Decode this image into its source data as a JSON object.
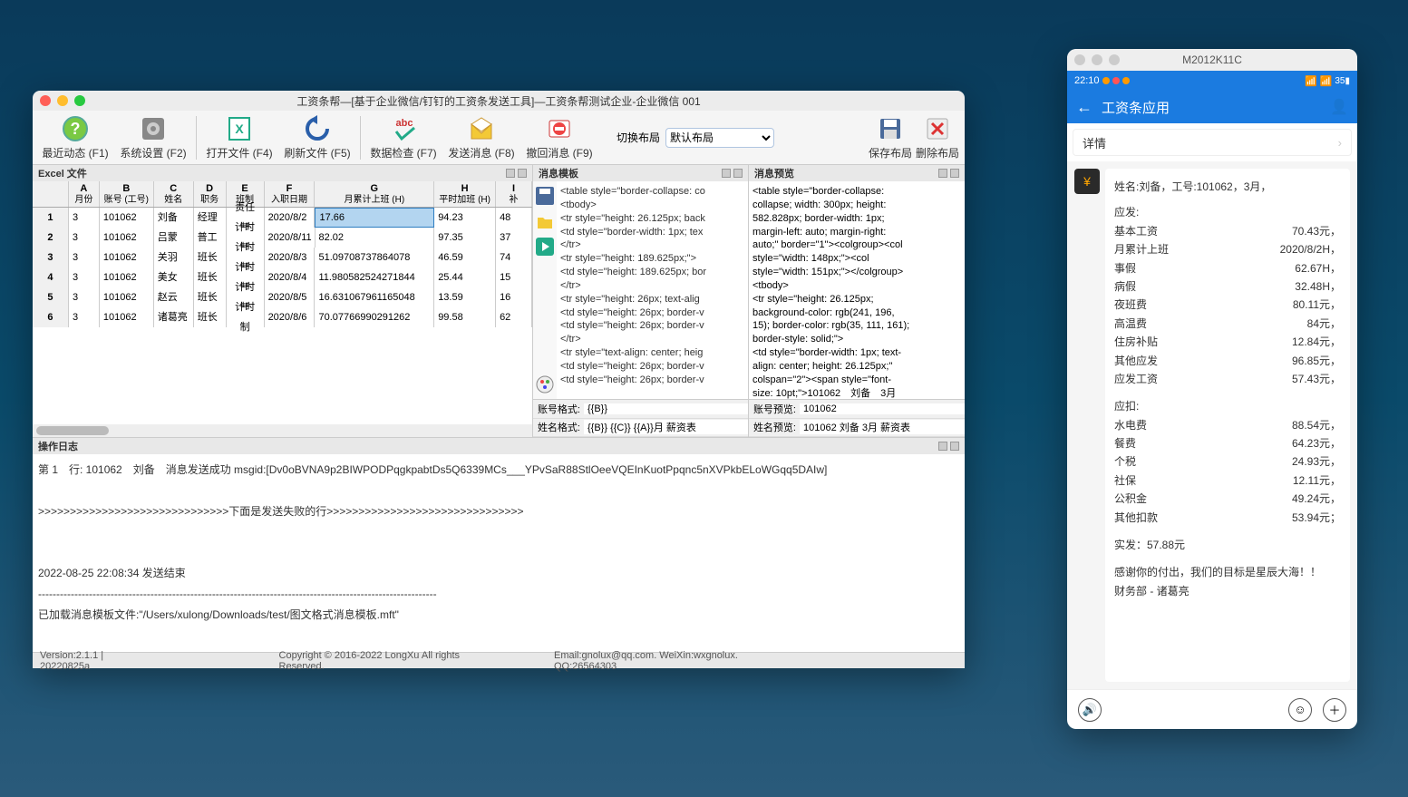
{
  "main": {
    "title": "工资条帮—[基于企业微信/钉钉的工资条发送工具]—工资条帮测试企业-企业微信 001",
    "toolbar": [
      {
        "label": "最近动态 (F1)",
        "icon": "help"
      },
      {
        "label": "系统设置 (F2)",
        "icon": "gear"
      },
      {
        "label": "打开文件 (F4)",
        "icon": "xls"
      },
      {
        "label": "刷新文件 (F5)",
        "icon": "refresh"
      },
      {
        "label": "数据检查 (F7)",
        "icon": "abc"
      },
      {
        "label": "发送消息 (F8)",
        "icon": "mail"
      },
      {
        "label": "撤回消息 (F9)",
        "icon": "undo"
      }
    ],
    "layout_label": "切换布局",
    "layout_value": "默认布局",
    "save_layout": "保存布局",
    "del_layout": "删除布局",
    "excel_title": "Excel 文件",
    "grid_headers": [
      {
        "col": "A",
        "name": "月份"
      },
      {
        "col": "B",
        "name": "账号 (工号)"
      },
      {
        "col": "C",
        "name": "姓名"
      },
      {
        "col": "D",
        "name": "职务"
      },
      {
        "col": "E",
        "name": "班制"
      },
      {
        "col": "F",
        "name": "入职日期"
      },
      {
        "col": "G",
        "name": "月累计上班 (H)"
      },
      {
        "col": "H",
        "name": "平时加班 (H)"
      },
      {
        "col": "I",
        "name": "补"
      }
    ],
    "grid_rows": [
      [
        "3",
        "101062",
        "刘备",
        "经理",
        "责任制",
        "2020/8/2",
        "17.66",
        "94.23",
        "48"
      ],
      [
        "3",
        "101062",
        "吕蒙",
        "普工",
        "计时制",
        "2020/8/11",
        "82.02",
        "97.35",
        "37"
      ],
      [
        "3",
        "101062",
        "关羽",
        "班长",
        "计时制",
        "2020/8/3",
        "51.09708737864078",
        "46.59",
        "74"
      ],
      [
        "3",
        "101062",
        "美女",
        "班长",
        "计时制",
        "2020/8/4",
        "11.980582524271844",
        "25.44",
        "15"
      ],
      [
        "3",
        "101062",
        "赵云",
        "班长",
        "计时制",
        "2020/8/5",
        "16.631067961165048",
        "13.59",
        "16"
      ],
      [
        "3",
        "101062",
        "诸葛亮",
        "班长",
        "计时制",
        "2020/8/6",
        "70.07766990291262",
        "99.58",
        "62"
      ]
    ],
    "tmpl_title": "消息模板",
    "tmpl_text": "<table style=\"border-collapse: co\n<tbody>\n<tr style=\"height: 26.125px; back\n<td style=\"border-width: 1px; tex\n</tr>\n<tr style=\"height: 189.625px;\">\n<td style=\"height: 189.625px; bor\n</tr>\n<tr style=\"height: 26px; text-alig\n<td style=\"height: 26px; border-v\n<td style=\"height: 26px; border-v\n</tr>\n<tr style=\"text-align: center; heig\n<td style=\"height: 26px; border-v\n<td style=\"height: 26px; border-v",
    "acct_fmt_label": "账号格式:",
    "acct_fmt_val": "{{B}}",
    "name_fmt_label": "姓名格式:",
    "name_fmt_val": "{{B}} {{C}} {{A}}月 薪资表",
    "prev_title": "消息预览",
    "prev_text": "<table style=\"border-collapse:\ncollapse; width: 300px; height:\n582.828px; border-width: 1px;\nmargin-left: auto; margin-right:\nauto;\" border=\"1\"><colgroup><col\nstyle=\"width: 148px;\"><col\nstyle=\"width: 151px;\"></colgroup>\n<tbody>\n<tr style=\"height: 26.125px;\nbackground-color: rgb(241, 196,\n15); border-color: rgb(35, 111, 161);\nborder-style: solid;\">\n<td style=\"border-width: 1px; text-\nalign: center; height: 26.125px;\"\ncolspan=\"2\"><span style=\"font-\nsize: 10pt;\">101062　刘备　3月",
    "acct_prev_label": "账号预览:",
    "acct_prev_val": "101062",
    "name_prev_label": "姓名预览:",
    "name_prev_val": "101062 刘备 3月 薪资表",
    "log_title": "操作日志",
    "log_body": "第 1　行: 101062　刘备　消息发送成功 msgid:[Dv0oBVNA9p2BIWPODPqgkpabtDs5Q6339MCs___YPvSaR88StlOeeVQEInKuotPpqnc5nXVPkbELoWGqq5DAIw]\n\n>>>>>>>>>>>>>>>>>>>>>>>>>>>>>>下面是发送失败的行>>>>>>>>>>>>>>>>>>>>>>>>>>>>>>>\n\n\n2022-08-25 22:08:34 发送结束\n--------------------------------------------------------------------------------------------------------------\n已加载消息模板文件:\"/Users/xulong/Downloads/test/图文格式消息模板.mft\"",
    "status": {
      "ver": "Version:2.1.1 | 20220825a",
      "cr": "Copyright © 2016-2022 LongXu All rights Reserved.",
      "contact": "Email:gnolux@qq.com.  WeiXin:wxgnolux. QQ:26564303"
    }
  },
  "phone": {
    "win_title": "M2012K11C",
    "time": "22:10",
    "hdr_title": "工资条应用",
    "detail": "详情",
    "header_line": "姓名:刘备，工号:101062，3月，",
    "yf": "应发:",
    "items_yf": [
      [
        "基本工资",
        "70.43元，"
      ],
      [
        "月累计上班",
        "2020/8/2H，"
      ],
      [
        "事假",
        "62.67H，"
      ],
      [
        "病假",
        "32.48H，"
      ],
      [
        "夜班费",
        "80.11元，"
      ],
      [
        "高温费",
        "84元，"
      ],
      [
        "住房补贴",
        "12.84元，"
      ],
      [
        "其他应发",
        "96.85元，"
      ],
      [
        "应发工资",
        "57.43元，"
      ]
    ],
    "yk": "应扣:",
    "items_yk": [
      [
        "水电费",
        "88.54元，"
      ],
      [
        "餐费",
        "64.23元，"
      ],
      [
        "个税",
        "24.93元，"
      ],
      [
        "社保",
        "12.11元，"
      ],
      [
        "公积金",
        "49.24元，"
      ],
      [
        "其他扣款",
        "53.94元；"
      ]
    ],
    "sf": "实发：57.88元",
    "thanks": "感谢你的付出，我们的目标是星辰大海！！",
    "dept": "财务部 - 诸葛亮"
  }
}
